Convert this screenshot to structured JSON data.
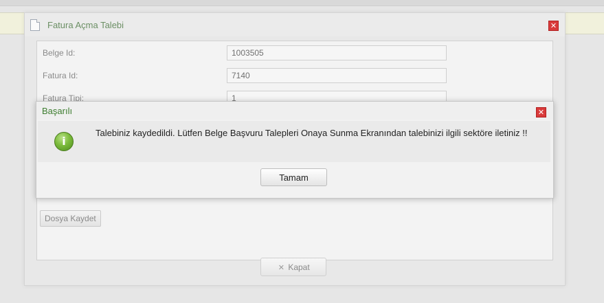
{
  "outer_dialog": {
    "title": "Fatura Açma Talebi",
    "icon": "document-icon",
    "close_icon": "close-icon",
    "fields": [
      {
        "label": "Belge Id:",
        "value": "1003505"
      },
      {
        "label": "Fatura Id:",
        "value": "7140"
      },
      {
        "label": "Fatura Tipi:",
        "value": "1"
      }
    ],
    "save_file_label": "Dosya Kaydet",
    "close_button_label": "Kapat"
  },
  "success_dialog": {
    "title": "Başarılı",
    "message": "Talebiniz kaydedildi. Lütfen Belge Başvuru Talepleri Onaya Sunma Ekranından talebinizi ilgili sektöre iletiniz !!",
    "ok_label": "Tamam",
    "info_icon_glyph": "i",
    "colors": {
      "title": "#3d7d2f",
      "close": "#d93b3b",
      "icon": "#7cbb3c"
    }
  },
  "x_glyph": "✕"
}
